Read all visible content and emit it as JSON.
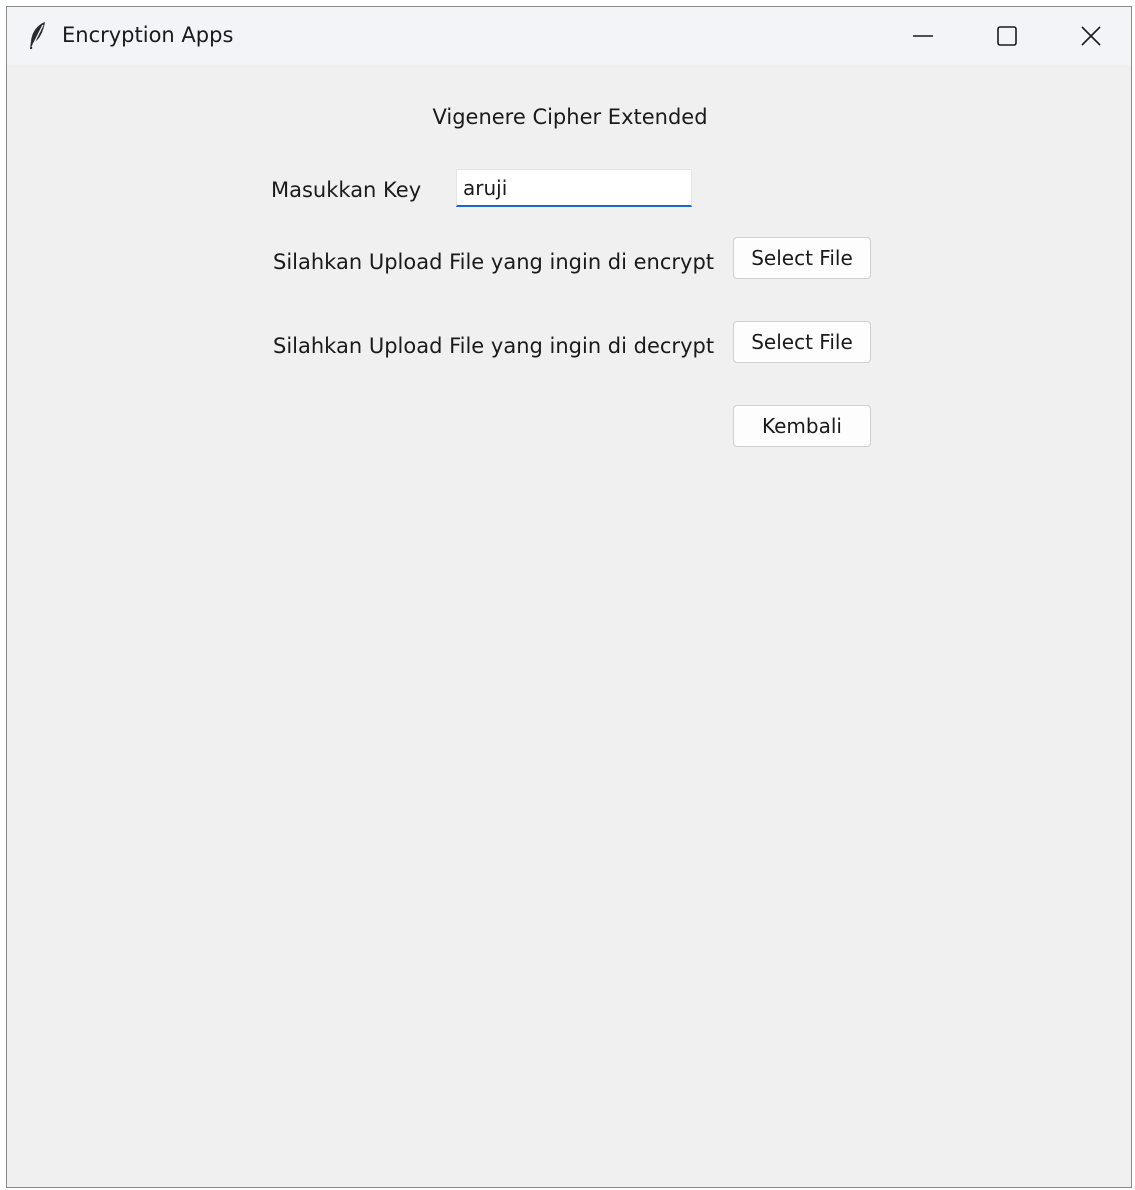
{
  "window": {
    "title": "Encryption Apps",
    "app_icon": "feather-icon",
    "controls": [
      "minimize-icon",
      "maximize-icon",
      "close-icon"
    ]
  },
  "main": {
    "heading": "Vigenere Cipher Extended",
    "key_label": "Masukkan Key",
    "key_value": "aruji",
    "encrypt_label": "Silahkan Upload File yang ingin di encrypt",
    "encrypt_button": "Select File",
    "decrypt_label": "Silahkan Upload File yang ingin di decrypt",
    "decrypt_button": "Select File",
    "back_button": "Kembali"
  },
  "colors": {
    "window_bg": "#f0f0f0",
    "titlebar_bg": "#f2f4f8",
    "input_focus_accent": "#1f66c9"
  }
}
